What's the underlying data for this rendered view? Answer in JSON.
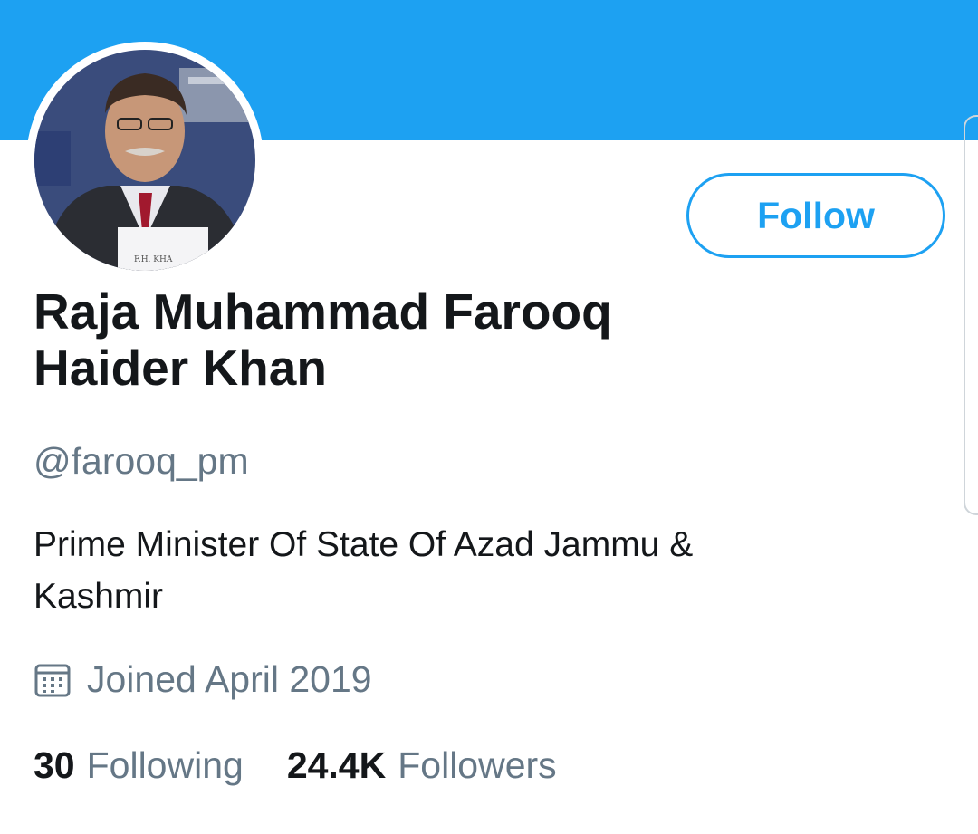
{
  "theme": {
    "accent": "#1da1f2",
    "text": "#14171a",
    "muted": "#657786"
  },
  "profile": {
    "display_name": "Raja Muhammad Farooq Haider Khan",
    "handle": "@farooq_pm",
    "bio": "Prime Minister Of State Of Azad Jammu & Kashmir",
    "joined": "Joined April 2019",
    "joined_icon": "calendar-icon"
  },
  "actions": {
    "follow_label": "Follow"
  },
  "stats": {
    "following_count": "30",
    "following_label": "Following",
    "followers_count": "24.4K",
    "followers_label": "Followers"
  }
}
